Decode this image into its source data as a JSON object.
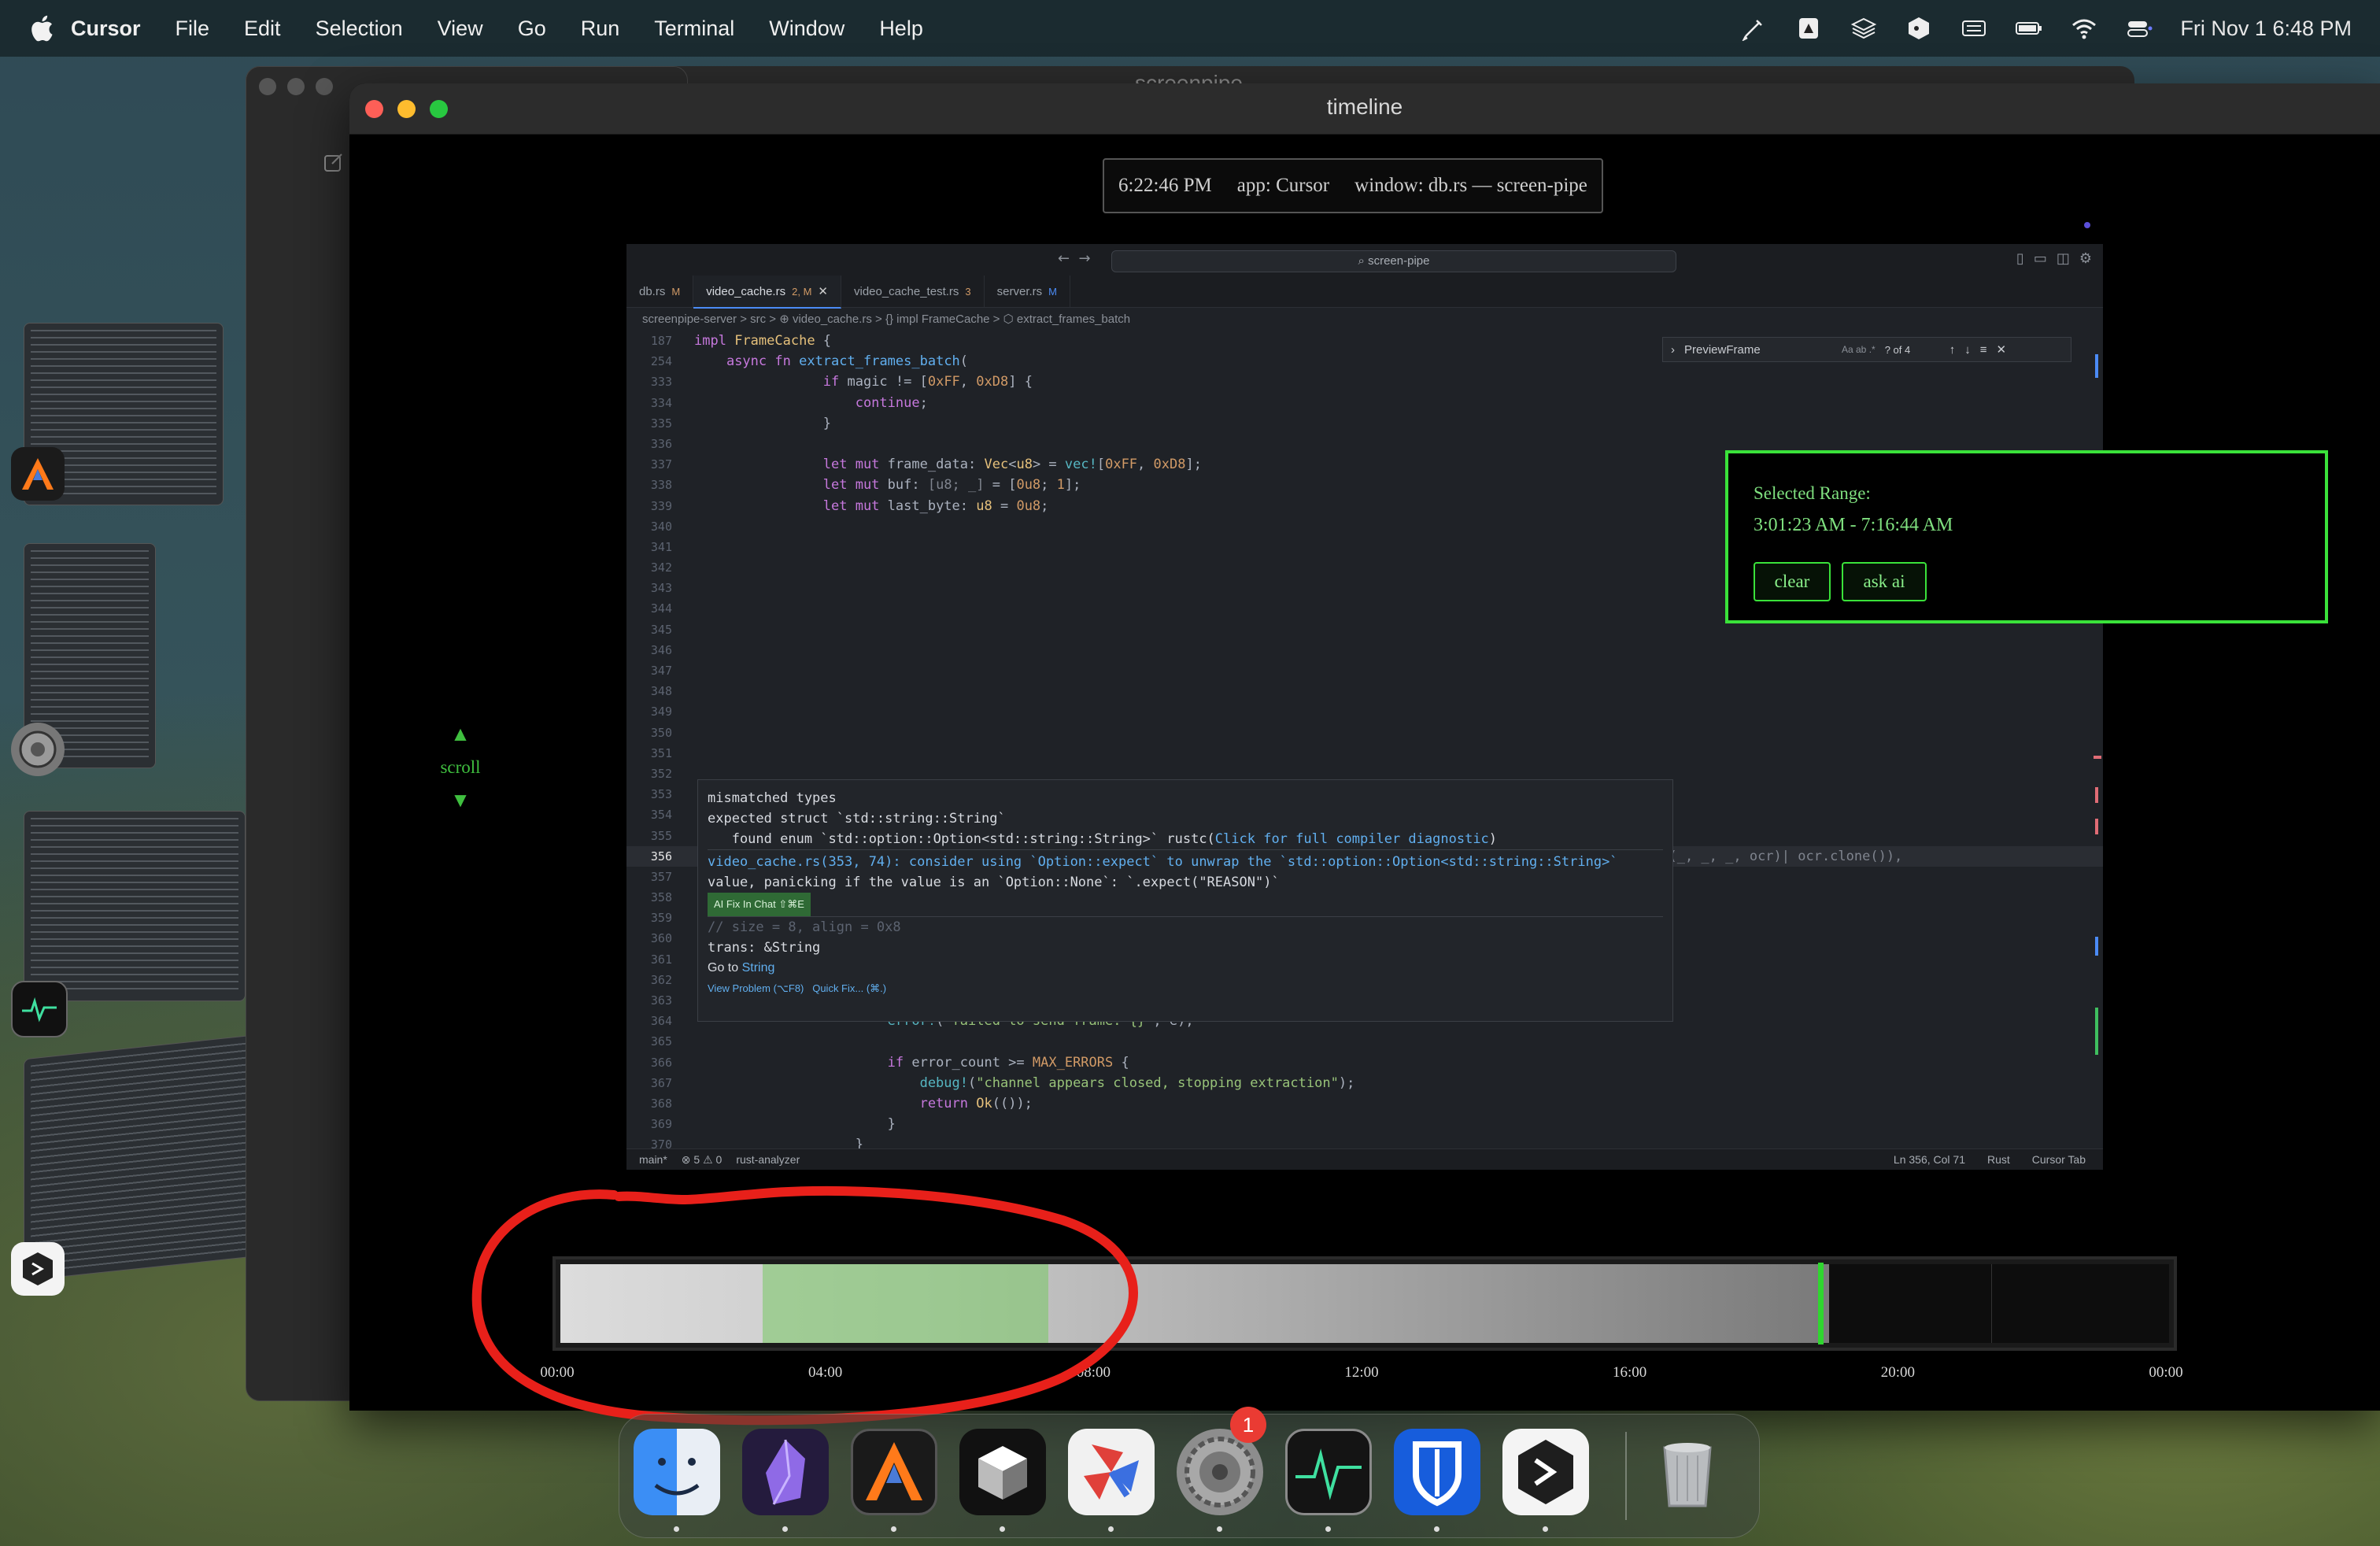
{
  "menubar": {
    "app_name": "Cursor",
    "items": [
      "File",
      "Edit",
      "Selection",
      "View",
      "Go",
      "Run",
      "Terminal",
      "Window",
      "Help"
    ],
    "clock": "Fri Nov 1  6:48 PM"
  },
  "background_window": {
    "title": "screenpipe"
  },
  "window": {
    "title": "timeline"
  },
  "frame_info": {
    "time": "6:22:46 PM",
    "app": "app: Cursor",
    "window": "window: db.rs — screen-pipe"
  },
  "ide": {
    "search": "⌕ screen-pipe",
    "tabs": [
      {
        "name": "db.rs",
        "mod": "M"
      },
      {
        "name": "video_cache.rs",
        "mod": "2, M",
        "active": true
      },
      {
        "name": "video_cache_test.rs",
        "mod": "3"
      },
      {
        "name": "server.rs",
        "mod": "M"
      }
    ],
    "breadcrumb": "screenpipe-server > src > ⊕ video_cache.rs > {} impl FrameCache > ⬡ extract_frames_batch",
    "find": {
      "value": "PreviewFrame",
      "options": "Aa  ab  .*",
      "count": "? of 4"
    },
    "hover": {
      "l1": "mismatched types",
      "l2": "expected struct `std::string::String`",
      "l3": "   found enum `std::option::Option<std::string::String>` rustc(",
      "l3_link": "Click for full compiler diagnostic",
      "l4": "video_cache.rs(353, 74): consider using `Option::expect` to unwrap the `std::option::Option<std::string::String>`",
      "l5": "value, panicking if the value is an `Option::None`: `.expect(\"REASON\")`",
      "fix_button": "AI Fix In Chat ⇧⌘E",
      "l6": "// size = 8, align = 0x8",
      "l7": "trans: &String",
      "goto": "Go to ",
      "goto_link": "String",
      "l8": "View Problem (⌥F8)   Quick Fix... (⌘.)"
    },
    "status": {
      "branch": "main*",
      "problems": "⊗ 5 ⚠ 0",
      "lsp": "rust-analyzer",
      "position": "Ln 356, Col 71",
      "language": "Rust",
      "mode": "Cursor Tab"
    }
  },
  "selected_range": {
    "label": "Selected Range:",
    "value": "3:01:23 AM - 7:16:44 AM",
    "clear": "clear",
    "ask_ai": "ask ai"
  },
  "scroll": {
    "label": "scroll",
    "up": "▲",
    "down": "▼"
  },
  "timeline": {
    "labels": [
      "00:00",
      "04:00",
      "08:00",
      "12:00",
      "16:00",
      "20:00",
      "00:00"
    ],
    "selection_start_hours": 3.02,
    "selection_end_hours": 7.28,
    "current_hours": 18.8
  },
  "dock": {
    "apps": [
      "finder-icon",
      "obsidian-icon",
      "cursor-icon",
      "cube-icon",
      "pinwheel-icon",
      "system-settings-icon",
      "activity-monitor-icon",
      "bitwarden-icon",
      "screenpipe-icon",
      "trash-icon"
    ],
    "settings_badge": "1"
  },
  "colors": {
    "accent_green": "#3ae23a",
    "annotation_red": "#e8201a"
  }
}
